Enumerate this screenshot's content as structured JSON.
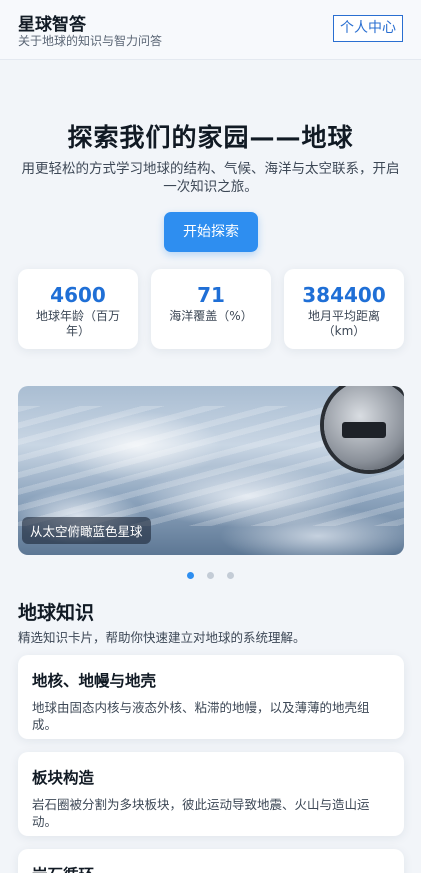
{
  "header": {
    "title": "星球智答",
    "subtitle": "关于地球的知识与智力问答",
    "profile_label": "个人中心"
  },
  "hero": {
    "title": "探索我们的家园——地球",
    "description": "用更轻松的方式学习地球的结构、气候、海洋与太空联系，开启一次知识之旅。",
    "cta_label": "开始探索"
  },
  "stats": [
    {
      "value": "4600",
      "label": "地球年龄（百万年）"
    },
    {
      "value": "71",
      "label": "海洋覆盖（%）"
    },
    {
      "value": "384400",
      "label": "地月平均距离（km）"
    }
  ],
  "carousel": {
    "caption": "从太空俯瞰蓝色星球",
    "slide_count": 3,
    "active_index": 0
  },
  "knowledge": {
    "title": "地球知识",
    "subtitle": "精选知识卡片，帮助你快速建立对地球的系统理解。",
    "cards": [
      {
        "title": "地核、地幔与地壳",
        "desc": "地球由固态内核与液态外核、粘滞的地幔，以及薄薄的地壳组成。"
      },
      {
        "title": "板块构造",
        "desc": "岩石圈被分割为多块板块，彼此运动导致地震、火山与造山运动。"
      },
      {
        "title": "岩石循环",
        "desc": ""
      }
    ]
  },
  "colors": {
    "accent": "#2e8ef0",
    "stat_value": "#1f6fd6",
    "background": "#f2f5f9"
  }
}
